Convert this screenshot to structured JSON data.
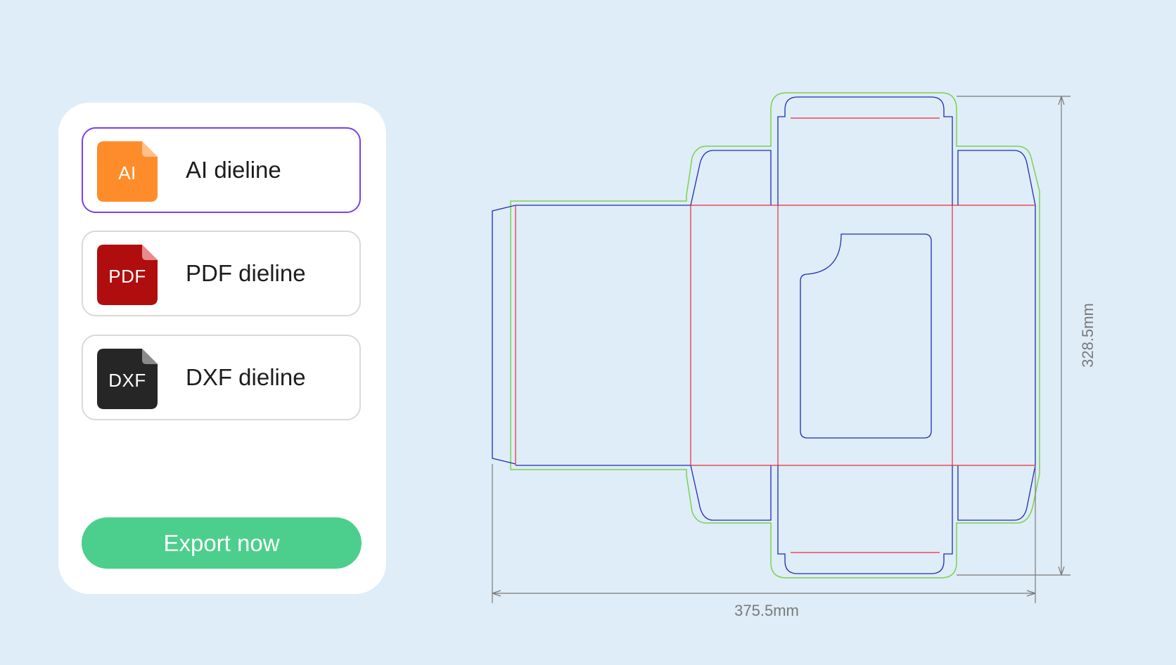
{
  "export_panel": {
    "options": [
      {
        "badge": "AI",
        "label": "AI dieline",
        "icon": "ai-file-icon",
        "color": "#ff8c2a",
        "selected": true
      },
      {
        "badge": "PDF",
        "label": "PDF dieline",
        "icon": "pdf-file-icon",
        "color": "#b00e0e",
        "selected": false
      },
      {
        "badge": "DXF",
        "label": "DXF dieline",
        "icon": "dxf-file-icon",
        "color": "#262626",
        "selected": false
      }
    ],
    "export_button": "Export now"
  },
  "dieline": {
    "width_label": "375.5mm",
    "height_label": "328.5mm",
    "colors": {
      "cut": "#1f2bb8",
      "fold": "#f0283a",
      "bleed": "#7bd24f",
      "dimension": "#7a7a7a"
    }
  }
}
